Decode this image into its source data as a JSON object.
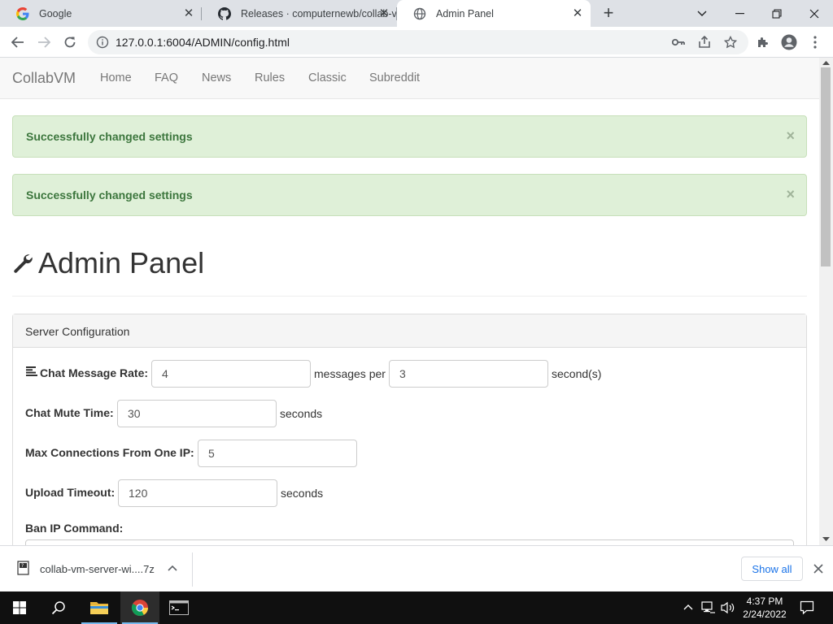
{
  "browser": {
    "tabs": [
      {
        "title": "Google",
        "icon": "google-icon"
      },
      {
        "title": "Releases · computernewb/collab-vm-server",
        "icon": "github-icon"
      },
      {
        "title": "Admin Panel",
        "icon": "globe-icon",
        "active": true
      }
    ],
    "url": "127.0.0.1:6004/ADMIN/config.html"
  },
  "navbar": {
    "brand": "CollabVM",
    "links": [
      "Home",
      "FAQ",
      "News",
      "Rules",
      "Classic",
      "Subreddit"
    ]
  },
  "alerts": [
    {
      "message": "Successfully changed settings",
      "close": "×"
    },
    {
      "message": "Successfully changed settings",
      "close": "×"
    }
  ],
  "page": {
    "title": "Admin Panel"
  },
  "panel": {
    "heading": "Server Configuration",
    "chat_rate": {
      "label": "Chat Message Rate:",
      "messages_value": "4",
      "messages_per": "messages per",
      "seconds_value": "3",
      "seconds_unit": "second(s)"
    },
    "mute_time": {
      "label": "Chat Mute Time:",
      "value": "30",
      "unit": "seconds"
    },
    "max_conn": {
      "label": "Max Connections From One IP:",
      "value": "5"
    },
    "upload_timeout": {
      "label": "Upload Timeout:",
      "value": "120",
      "unit": "seconds"
    },
    "ban_ip": {
      "label": "Ban IP Command:"
    }
  },
  "download_bar": {
    "filename": "collab-vm-server-wi....7z",
    "show_all": "Show all"
  },
  "taskbar": {
    "time": "4:37 PM",
    "date": "2/24/2022"
  },
  "colors": {
    "alert_bg": "#dff0d8",
    "alert_text": "#3c763d",
    "navbar_bg": "#f8f8f8",
    "taskbar_bg": "#101010"
  }
}
